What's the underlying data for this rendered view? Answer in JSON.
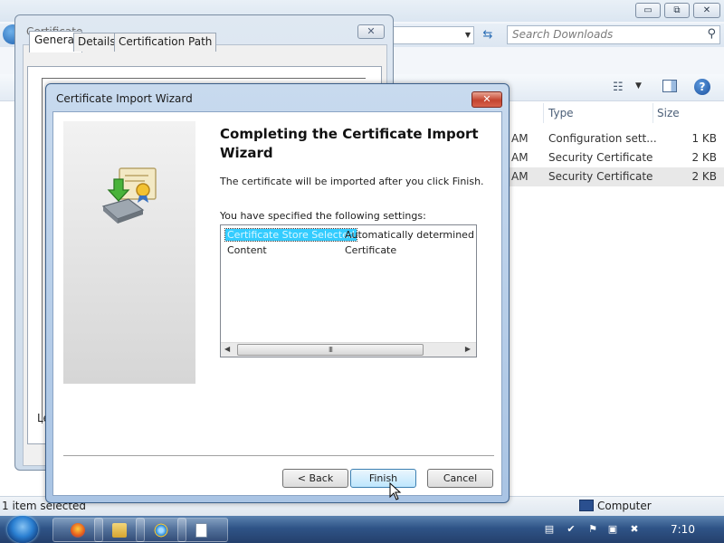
{
  "explorer": {
    "caption_buttons": {
      "minimize": "▭",
      "maximize": "⧉",
      "close": "✕"
    },
    "search_placeholder": "Search Downloads",
    "columns": {
      "type": "Type",
      "size": "Size"
    },
    "rows": [
      {
        "time": "AM",
        "type": "Configuration sett...",
        "size": "1 KB"
      },
      {
        "time": "AM",
        "type": "Security Certificate",
        "size": "2 KB"
      },
      {
        "time": "AM",
        "type": "Security Certificate",
        "size": "2 KB"
      }
    ],
    "status": "1 item selected",
    "computer_label": "Computer"
  },
  "certificate_window": {
    "title": "Certificate",
    "close_glyph": "✕",
    "tabs": [
      "General",
      "Details",
      "Certification Path"
    ],
    "partial_text": "Le"
  },
  "wizard": {
    "title": "Certificate Import Wizard",
    "close_glyph": "✕",
    "heading": "Completing the Certificate Import Wizard",
    "description": "The certificate will be imported after you click Finish.",
    "settings_label": "You have specified the following settings:",
    "settings": [
      {
        "key": "Certificate Store Selected",
        "value": "Automatically determined by t"
      },
      {
        "key": "Content",
        "value": "Certificate"
      }
    ],
    "scroll_grip": "III",
    "buttons": {
      "back": "< Back",
      "finish": "Finish",
      "cancel": "Cancel"
    }
  },
  "taskbar": {
    "clock": "7:10"
  }
}
